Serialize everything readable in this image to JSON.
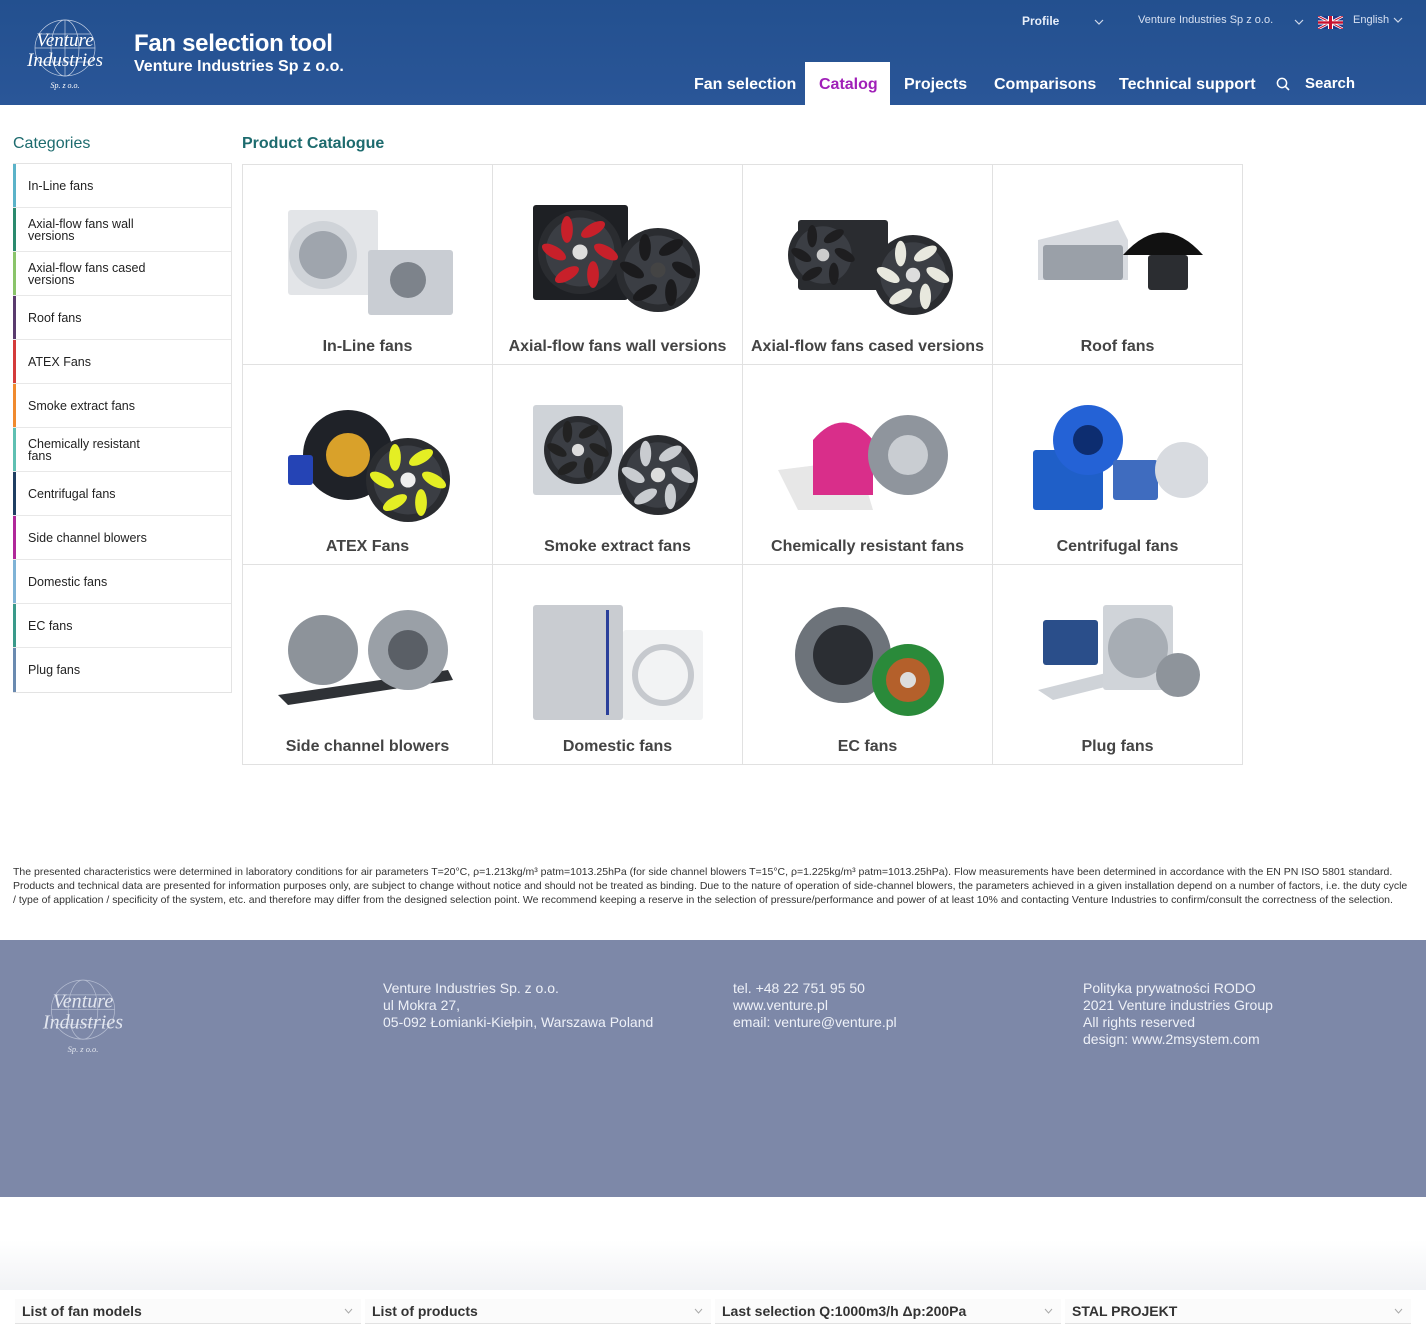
{
  "header": {
    "logo_text": [
      "Venture",
      "Industries",
      "Sp. z o.o."
    ],
    "title": "Fan selection tool",
    "subtitle": "Venture Industries Sp z o.o.",
    "util": {
      "profile": "Profile",
      "company": "Venture Industries Sp z o.o.",
      "language": "English"
    },
    "nav": [
      {
        "label": "Fan selection",
        "active": false
      },
      {
        "label": "Catalog",
        "active": true
      },
      {
        "label": "Projects",
        "active": false
      },
      {
        "label": "Comparisons",
        "active": false
      },
      {
        "label": "Technical support",
        "active": false
      }
    ],
    "search_label": "Search"
  },
  "sidebar": {
    "title": "Categories",
    "items": [
      {
        "label": "In-Line fans",
        "color": "#5bb3c9"
      },
      {
        "label": "Axial-flow fans wall versions",
        "color": "#2a8a6e"
      },
      {
        "label": "Axial-flow fans cased versions",
        "color": "#8ac46a"
      },
      {
        "label": "Roof fans",
        "color": "#5a3b6e"
      },
      {
        "label": "ATEX Fans",
        "color": "#d43b3b"
      },
      {
        "label": "Smoke extract fans",
        "color": "#f08a2e"
      },
      {
        "label": "Chemically resistant fans",
        "color": "#5fc0b2"
      },
      {
        "label": "Centrifugal fans",
        "color": "#1f3e62"
      },
      {
        "label": "Side channel blowers",
        "color": "#b0289a"
      },
      {
        "label": "Domestic fans",
        "color": "#7fb3d6"
      },
      {
        "label": "EC fans",
        "color": "#3a9a8a"
      },
      {
        "label": "Plug fans",
        "color": "#6a8ab0"
      }
    ]
  },
  "catalogue": {
    "title": "Product Catalogue",
    "products": [
      {
        "label": "In-Line fans",
        "icon": "inline-fan-image"
      },
      {
        "label": "Axial-flow fans wall versions",
        "icon": "axial-wall-fan-image"
      },
      {
        "label": "Axial-flow fans cased versions",
        "icon": "axial-cased-fan-image"
      },
      {
        "label": "Roof fans",
        "icon": "roof-fan-image"
      },
      {
        "label": "ATEX Fans",
        "icon": "atex-fan-image"
      },
      {
        "label": "Smoke extract fans",
        "icon": "smoke-extract-fan-image"
      },
      {
        "label": "Chemically resistant fans",
        "icon": "chemical-fan-image"
      },
      {
        "label": "Centrifugal fans",
        "icon": "centrifugal-fan-image"
      },
      {
        "label": "Side channel blowers",
        "icon": "side-channel-blower-image"
      },
      {
        "label": "Domestic fans",
        "icon": "domestic-fan-image"
      },
      {
        "label": "EC fans",
        "icon": "ec-fan-image"
      },
      {
        "label": "Plug fans",
        "icon": "plug-fan-image"
      }
    ]
  },
  "disclaimer": "The presented characteristics were determined in laboratory conditions for air parameters T=20°C, ρ=1.213kg/m³ patm=1013.25hPa (for side channel blowers T=15°C, ρ=1.225kg/m³ patm=1013.25hPa). Flow measurements have been determined in accordance with the EN PN ISO 5801 standard. Products and technical data are presented for information purposes only, are subject to change without notice and should not be treated as binding. Due to the nature of operation of side-channel blowers, the parameters achieved in a given installation depend on a number of factors, i.e. the duty cycle / type of application / specificity of the system, etc. and therefore may differ from the designed selection point. We recommend keeping a reserve in the selection of pressure/performance and power of at least 10% and contacting Venture Industries to confirm/consult the correctness of the selection.",
  "footer": {
    "logo_text": [
      "Venture",
      "Industries",
      "Sp. z o.o."
    ],
    "address": [
      "Venture Industries Sp. z o.o.",
      "ul Mokra 27,",
      "05-092 Łomianki-Kiełpin, Warszawa Poland"
    ],
    "contact": [
      "tel. +48 22 751 95 50",
      "www.venture.pl",
      "email: venture@venture.pl"
    ],
    "legal": [
      "Polityka prywatności RODO",
      "2021 Venture industries Group",
      "All rights reserved",
      "design: www.2msystem.com"
    ]
  },
  "bottom_bar": [
    "List of fan models",
    "List of products",
    "Last selection Q:1000m3/h Δp:200Pa",
    "STAL PROJEKT"
  ],
  "colors": {
    "header_bg": "#23508f",
    "accent_active": "#a020b8",
    "heading_teal": "#1d6b6e",
    "footer_bg": "#7d88a8"
  }
}
